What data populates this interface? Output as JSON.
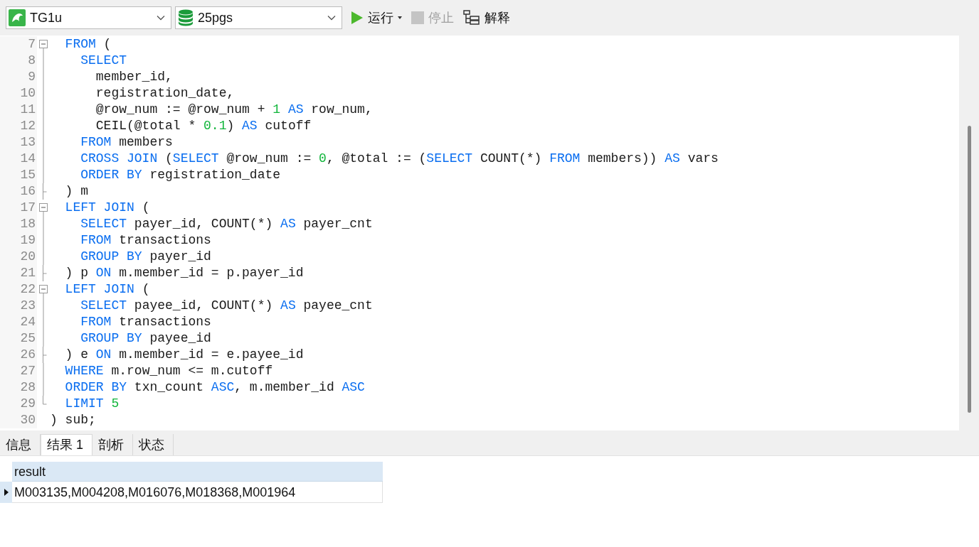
{
  "toolbar": {
    "connection": {
      "value": "TG1u"
    },
    "database": {
      "value": "25pgs"
    },
    "buttons": [
      {
        "kind": "run",
        "label": "运行",
        "dropdown": true,
        "disabled": false
      },
      {
        "kind": "stop",
        "label": "停止",
        "dropdown": false,
        "disabled": true
      },
      {
        "kind": "explain",
        "label": "解释",
        "dropdown": false,
        "disabled": false
      }
    ]
  },
  "editor": {
    "lines": [
      {
        "number": "7",
        "kind": "start",
        "tokens": [
          {
            "kind": "keyword",
            "text": "  FROM"
          },
          {
            "kind": "plain",
            "text": " ("
          }
        ]
      },
      {
        "number": "8",
        "kind": "body",
        "tokens": [
          {
            "kind": "keyword",
            "text": "    SELECT"
          }
        ]
      },
      {
        "number": "9",
        "kind": "body",
        "tokens": [
          {
            "kind": "plain",
            "text": "      member_id,"
          }
        ]
      },
      {
        "number": "10",
        "kind": "body",
        "tokens": [
          {
            "kind": "plain",
            "text": "      registration_date,"
          }
        ]
      },
      {
        "number": "11",
        "kind": "body",
        "tokens": [
          {
            "kind": "plain",
            "text": "      @row_num := @row_num + "
          },
          {
            "kind": "number",
            "text": "1"
          },
          {
            "kind": "keyword",
            "text": " AS"
          },
          {
            "kind": "plain",
            "text": " row_num,"
          }
        ]
      },
      {
        "number": "12",
        "kind": "body",
        "tokens": [
          {
            "kind": "plain",
            "text": "      CEIL(@total * "
          },
          {
            "kind": "number",
            "text": "0.1"
          },
          {
            "kind": "plain",
            "text": ") "
          },
          {
            "kind": "keyword",
            "text": "AS"
          },
          {
            "kind": "plain",
            "text": " cutoff"
          }
        ]
      },
      {
        "number": "13",
        "kind": "body",
        "tokens": [
          {
            "kind": "keyword",
            "text": "    FROM"
          },
          {
            "kind": "plain",
            "text": " members"
          }
        ]
      },
      {
        "number": "14",
        "kind": "body",
        "tokens": [
          {
            "kind": "keyword",
            "text": "    CROSS JOIN"
          },
          {
            "kind": "plain",
            "text": " ("
          },
          {
            "kind": "keyword",
            "text": "SELECT"
          },
          {
            "kind": "plain",
            "text": " @row_num := "
          },
          {
            "kind": "number",
            "text": "0"
          },
          {
            "kind": "plain",
            "text": ", @total := ("
          },
          {
            "kind": "keyword",
            "text": "SELECT"
          },
          {
            "kind": "plain",
            "text": " COUNT(*) "
          },
          {
            "kind": "keyword",
            "text": "FROM"
          },
          {
            "kind": "plain",
            "text": " members)) "
          },
          {
            "kind": "keyword",
            "text": "AS"
          },
          {
            "kind": "plain",
            "text": " vars"
          }
        ]
      },
      {
        "number": "15",
        "kind": "body",
        "tokens": [
          {
            "kind": "keyword",
            "text": "    ORDER BY"
          },
          {
            "kind": "plain",
            "text": " registration_date"
          }
        ]
      },
      {
        "number": "16",
        "kind": "end",
        "tokens": [
          {
            "kind": "plain",
            "text": "  ) m"
          }
        ]
      },
      {
        "number": "17",
        "kind": "start",
        "tokens": [
          {
            "kind": "keyword",
            "text": "  LEFT JOIN"
          },
          {
            "kind": "plain",
            "text": " ("
          }
        ]
      },
      {
        "number": "18",
        "kind": "body",
        "tokens": [
          {
            "kind": "keyword",
            "text": "    SELECT"
          },
          {
            "kind": "plain",
            "text": " payer_id, COUNT(*) "
          },
          {
            "kind": "keyword",
            "text": "AS"
          },
          {
            "kind": "plain",
            "text": " payer_cnt"
          }
        ]
      },
      {
        "number": "19",
        "kind": "body",
        "tokens": [
          {
            "kind": "keyword",
            "text": "    FROM"
          },
          {
            "kind": "plain",
            "text": " transactions"
          }
        ]
      },
      {
        "number": "20",
        "kind": "body",
        "tokens": [
          {
            "kind": "keyword",
            "text": "    GROUP BY"
          },
          {
            "kind": "plain",
            "text": " payer_id"
          }
        ]
      },
      {
        "number": "21",
        "kind": "end",
        "tokens": [
          {
            "kind": "plain",
            "text": "  ) p "
          },
          {
            "kind": "keyword",
            "text": "ON"
          },
          {
            "kind": "plain",
            "text": " m.member_id = p.payer_id"
          }
        ]
      },
      {
        "number": "22",
        "kind": "start",
        "tokens": [
          {
            "kind": "keyword",
            "text": "  LEFT JOIN"
          },
          {
            "kind": "plain",
            "text": " ("
          }
        ]
      },
      {
        "number": "23",
        "kind": "body",
        "tokens": [
          {
            "kind": "keyword",
            "text": "    SELECT"
          },
          {
            "kind": "plain",
            "text": " payee_id, COUNT(*) "
          },
          {
            "kind": "keyword",
            "text": "AS"
          },
          {
            "kind": "plain",
            "text": " payee_cnt"
          }
        ]
      },
      {
        "number": "24",
        "kind": "body",
        "tokens": [
          {
            "kind": "keyword",
            "text": "    FROM"
          },
          {
            "kind": "plain",
            "text": " transactions"
          }
        ]
      },
      {
        "number": "25",
        "kind": "body",
        "tokens": [
          {
            "kind": "keyword",
            "text": "    GROUP BY"
          },
          {
            "kind": "plain",
            "text": " payee_id"
          }
        ]
      },
      {
        "number": "26",
        "kind": "end",
        "tokens": [
          {
            "kind": "plain",
            "text": "  ) e "
          },
          {
            "kind": "keyword",
            "text": "ON"
          },
          {
            "kind": "plain",
            "text": " m.member_id = e.payee_id"
          }
        ]
      },
      {
        "number": "27",
        "kind": "body",
        "tokens": [
          {
            "kind": "keyword",
            "text": "  WHERE"
          },
          {
            "kind": "plain",
            "text": " m.row_num <= m.cutoff"
          }
        ]
      },
      {
        "number": "28",
        "kind": "body",
        "tokens": [
          {
            "kind": "keyword",
            "text": "  ORDER BY"
          },
          {
            "kind": "plain",
            "text": " txn_count "
          },
          {
            "kind": "keyword",
            "text": "ASC"
          },
          {
            "kind": "plain",
            "text": ", m.member_id "
          },
          {
            "kind": "keyword",
            "text": "ASC"
          }
        ]
      },
      {
        "number": "29",
        "kind": "end",
        "tokens": [
          {
            "kind": "keyword",
            "text": "  LIMIT"
          },
          {
            "kind": "number",
            "text": " 5"
          }
        ]
      },
      {
        "number": "30",
        "kind": "plain",
        "tokens": [
          {
            "kind": "plain",
            "text": ") sub;"
          }
        ]
      }
    ]
  },
  "result_tabs": [
    {
      "label": "信息",
      "selected": false
    },
    {
      "label": "结果 1",
      "selected": true
    },
    {
      "label": "剖析",
      "selected": false
    },
    {
      "label": "状态",
      "selected": false
    }
  ],
  "result_grid": {
    "columns": [
      "result"
    ],
    "rows": [
      {
        "current": true,
        "cells": [
          "M003135,M004208,M016076,M018368,M001964"
        ]
      }
    ]
  }
}
